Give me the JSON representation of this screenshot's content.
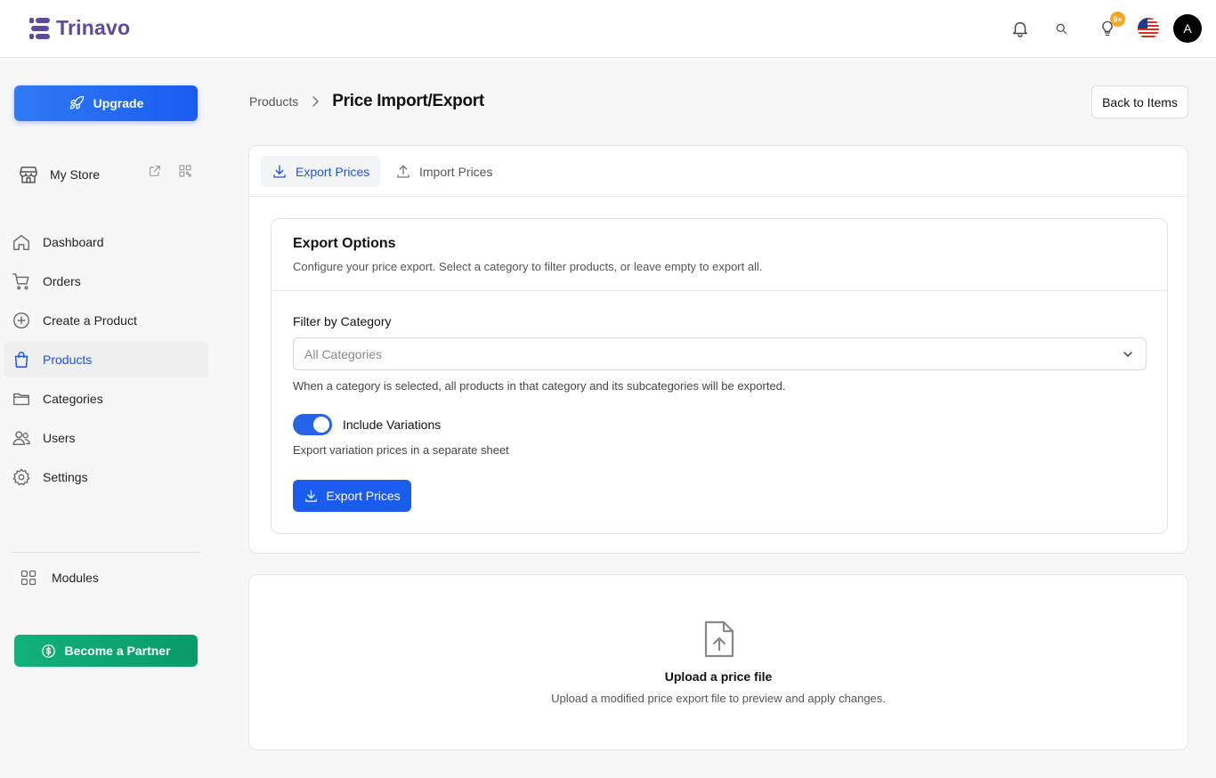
{
  "app": {
    "name": "Trinavo"
  },
  "header": {
    "notification_badge": "9+",
    "avatar_initial": "A",
    "icons": [
      "bell-icon",
      "search-icon",
      "lightbulb-icon",
      "us-flag-icon"
    ]
  },
  "sidebar": {
    "upgrade_label": "Upgrade",
    "store_label": "My Store",
    "items": [
      {
        "label": "Dashboard",
        "icon": "home-icon"
      },
      {
        "label": "Orders",
        "icon": "cart-icon"
      },
      {
        "label": "Create a Product",
        "icon": "plus-circle-icon"
      },
      {
        "label": "Products",
        "icon": "shopping-bag-icon",
        "active": true
      },
      {
        "label": "Categories",
        "icon": "folder-icon"
      },
      {
        "label": "Users",
        "icon": "users-icon"
      },
      {
        "label": "Settings",
        "icon": "gear-icon"
      }
    ],
    "modules_label": "Modules",
    "partner_label": "Become a Partner"
  },
  "breadcrumb": {
    "parent": "Products",
    "current": "Price Import/Export"
  },
  "back_button": "Back to Items",
  "tabs": [
    {
      "label": "Export Prices",
      "active": true
    },
    {
      "label": "Import Prices",
      "active": false
    }
  ],
  "export_options": {
    "title": "Export Options",
    "description": "Configure your price export. Select a category to filter products, or leave empty to export all.",
    "filter_label": "Filter by Category",
    "filter_value": "All Categories",
    "filter_help": "When a category is selected, all products in that category and its subcategories will be exported.",
    "include_variations_label": "Include Variations",
    "include_variations_on": true,
    "include_variations_help": "Export variation prices in a separate sheet",
    "export_button": "Export Prices"
  },
  "upload": {
    "title": "Upload a price file",
    "description": "Upload a modified price export file to preview and apply changes."
  },
  "colors": {
    "primary": "#1a5bf0",
    "active_text": "#1a56db",
    "partner_green": "#12b07a",
    "badge": "#f5a623",
    "logo": "#5b4a9e"
  }
}
